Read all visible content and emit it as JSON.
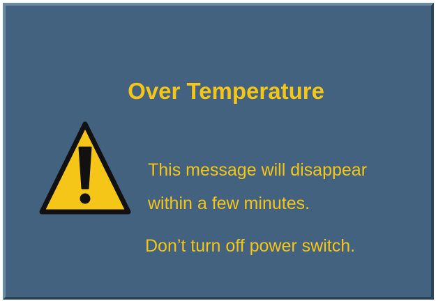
{
  "dialog": {
    "title": "Over Temperature",
    "icon": "warning-triangle-icon",
    "message_lines": [
      "This message will disappear",
      "within a few minutes.",
      "Don’t turn off power switch."
    ]
  },
  "colors": {
    "background": "#42627f",
    "text": "#f5c518",
    "icon_fill": "#f5c518",
    "icon_outline": "#111111"
  }
}
